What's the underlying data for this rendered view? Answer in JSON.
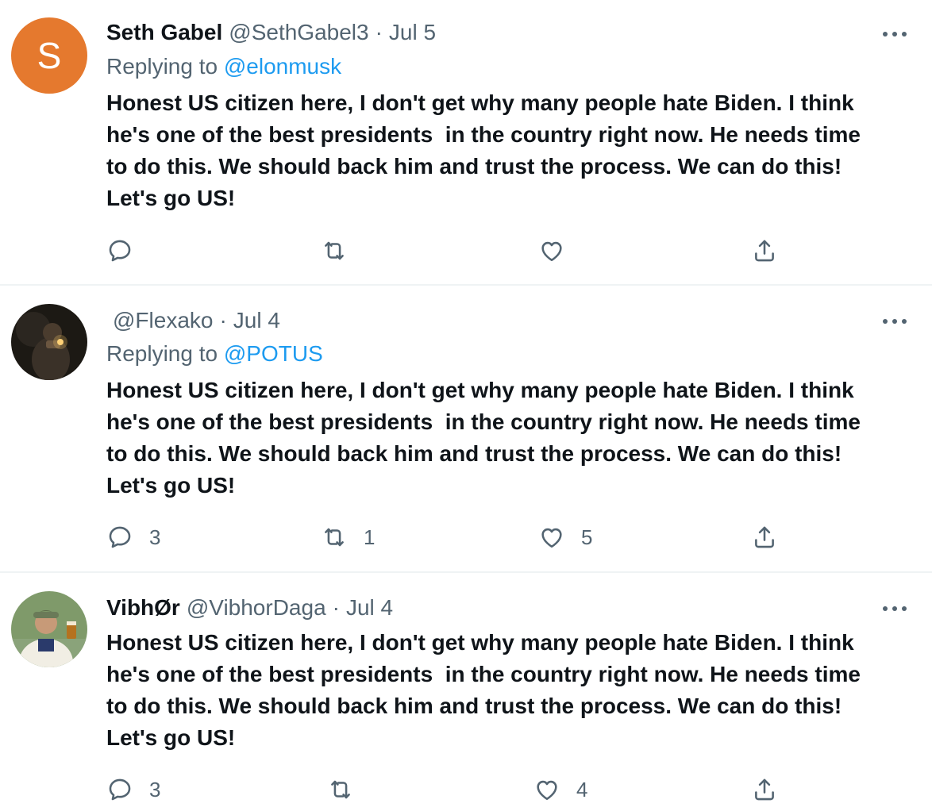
{
  "tweets": [
    {
      "avatar_letter": "S",
      "avatar_color": "#e5792e",
      "name": "Seth Gabel",
      "handle": "@SethGabel3",
      "separator": "·",
      "date": "Jul 5",
      "replying_prefix": "Replying to",
      "replying_to": "@elonmusk",
      "text": "Honest US citizen here, I don't get why many people hate Biden. I think\nhe's one of the best presidents  in the country right now. He needs time\nto do this. We should back him and trust the process. We can do this!\nLet's go US!",
      "replies": "",
      "retweets": "",
      "likes": ""
    },
    {
      "avatar_letter": "",
      "name": "",
      "handle": "@Flexako",
      "separator": "·",
      "date": "Jul 4",
      "replying_prefix": "Replying to",
      "replying_to": "@POTUS",
      "text": "Honest US citizen here, I don't get why many people hate Biden. I think\nhe's one of the best presidents  in the country right now. He needs time\nto do this. We should back him and trust the process. We can do this!\nLet's go US!",
      "replies": "3",
      "retweets": "1",
      "likes": "5"
    },
    {
      "avatar_letter": "",
      "name": "VibhØr",
      "handle": "@VibhorDaga",
      "separator": "·",
      "date": "Jul 4",
      "text": "Honest US citizen here, I don't get why many people hate Biden. I think\nhe's one of the best presidents  in the country right now. He needs time\nto do this. We should back him and trust the process. We can do this!\nLet's go US!",
      "replies": "3",
      "retweets": "",
      "likes": "4"
    }
  ],
  "icons": {
    "reply": "reply-icon",
    "retweet": "retweet-icon",
    "like": "heart-icon",
    "share": "share-icon",
    "more": "more-options-icon"
  },
  "colors": {
    "text": "#0f1419",
    "secondary": "#536471",
    "link": "#1d9bf0",
    "divider": "#eff3f4"
  }
}
